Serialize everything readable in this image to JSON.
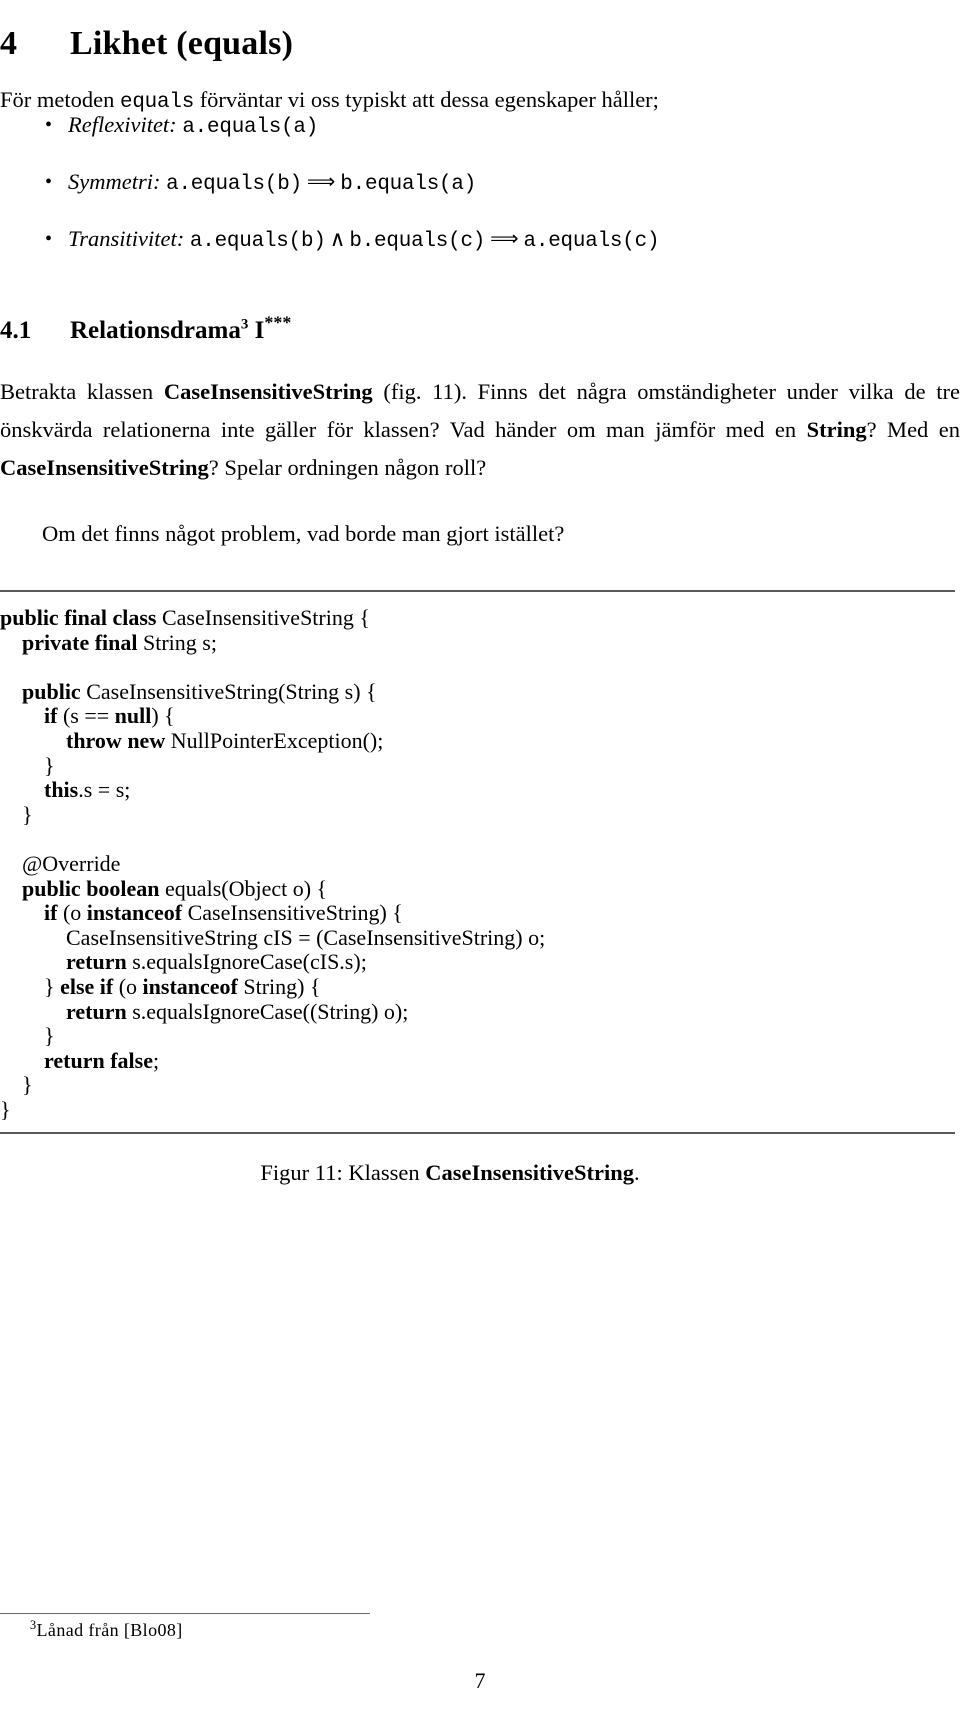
{
  "document": {
    "section": {
      "number": "4",
      "title": "Likhet (equals)"
    },
    "intro_paragraph": {
      "before_code": "För metoden ",
      "code": "equals",
      "after_code": " förväntar vi oss typiskt att dessa egenskaper håller;"
    },
    "properties": [
      {
        "label": "Reflexivitet:",
        "expr_1": "a.equals(a)",
        "op_1": "",
        "expr_2": "",
        "op_2": "",
        "expr_3": ""
      },
      {
        "label": "Symmetri:",
        "expr_1": "a.equals(b)",
        "op_1": "⟹",
        "expr_2": "b.equals(a)",
        "op_2": "",
        "expr_3": ""
      },
      {
        "label": "Transitivitet:",
        "expr_1": "a.equals(b)",
        "op_1": "∧",
        "expr_2": "b.equals(c)",
        "op_2": "⟹",
        "expr_3": "a.equals(c)"
      }
    ],
    "subsection": {
      "number": "4.1",
      "title": "Relationsdrama",
      "footnote_marker": "3",
      "suffix": "I",
      "stars": "***"
    },
    "body": {
      "betrakta_1": "Betrakta klassen ",
      "betrakta_class": "CaseInsensitiveString",
      "betrakta_2": " (fig. 11). Finns det några omständigheter under vilka de tre önskvärda relationerna inte gäller för klassen? Vad händer om man jämför med en ",
      "betrakta_string": "String",
      "betrakta_3": "? Med en ",
      "betrakta_class2": "CaseInsensitiveString",
      "betrakta_4": "? Spelar ordningen någon roll?",
      "om_det": "Om det finns något problem, vad borde man gjort istället?"
    },
    "figure": {
      "code_lines": [
        [
          {
            "t": "public final class ",
            "b": true
          },
          {
            "t": "CaseInsensitiveString {",
            "b": false
          }
        ],
        [
          {
            "t": "    private final ",
            "b": true
          },
          {
            "t": "String s;",
            "b": false
          }
        ],
        [
          {
            "t": "",
            "b": false
          }
        ],
        [
          {
            "t": "    public ",
            "b": true
          },
          {
            "t": "CaseInsensitiveString(String s) {",
            "b": false
          }
        ],
        [
          {
            "t": "        if ",
            "b": true
          },
          {
            "t": "(s == ",
            "b": false
          },
          {
            "t": "null",
            "b": true
          },
          {
            "t": ") {",
            "b": false
          }
        ],
        [
          {
            "t": "            throw new ",
            "b": true
          },
          {
            "t": "NullPointerException();",
            "b": false
          }
        ],
        [
          {
            "t": "        }",
            "b": false
          }
        ],
        [
          {
            "t": "        this",
            "b": true
          },
          {
            "t": ".s = s;",
            "b": false
          }
        ],
        [
          {
            "t": "    }",
            "b": false
          }
        ],
        [
          {
            "t": "",
            "b": false
          }
        ],
        [
          {
            "t": "    @Override",
            "b": false
          }
        ],
        [
          {
            "t": "    public boolean ",
            "b": true
          },
          {
            "t": "equals(Object o) {",
            "b": false
          }
        ],
        [
          {
            "t": "        if ",
            "b": true
          },
          {
            "t": "(o ",
            "b": false
          },
          {
            "t": "instanceof ",
            "b": true
          },
          {
            "t": "CaseInsensitiveString) {",
            "b": false
          }
        ],
        [
          {
            "t": "            CaseInsensitiveString cIS = (CaseInsensitiveString) o;",
            "b": false
          }
        ],
        [
          {
            "t": "            return ",
            "b": true
          },
          {
            "t": "s.equalsIgnoreCase(cIS.s);",
            "b": false
          }
        ],
        [
          {
            "t": "        } ",
            "b": false
          },
          {
            "t": "else if ",
            "b": true
          },
          {
            "t": "(o ",
            "b": false
          },
          {
            "t": "instanceof ",
            "b": true
          },
          {
            "t": "String) {",
            "b": false
          }
        ],
        [
          {
            "t": "            return ",
            "b": true
          },
          {
            "t": "s.equalsIgnoreCase((String) o);",
            "b": false
          }
        ],
        [
          {
            "t": "        }",
            "b": false
          }
        ],
        [
          {
            "t": "        return false",
            "b": true
          },
          {
            "t": ";",
            "b": false
          }
        ],
        [
          {
            "t": "    }",
            "b": false
          }
        ],
        [
          {
            "t": "}",
            "b": false
          }
        ]
      ],
      "caption_prefix": "Figur 11: Klassen ",
      "caption_class": "CaseInsensitiveString",
      "caption_suffix": "."
    },
    "footnote": {
      "marker": "3",
      "text": "Lånad från [Blo08]"
    },
    "page_number": "7"
  }
}
